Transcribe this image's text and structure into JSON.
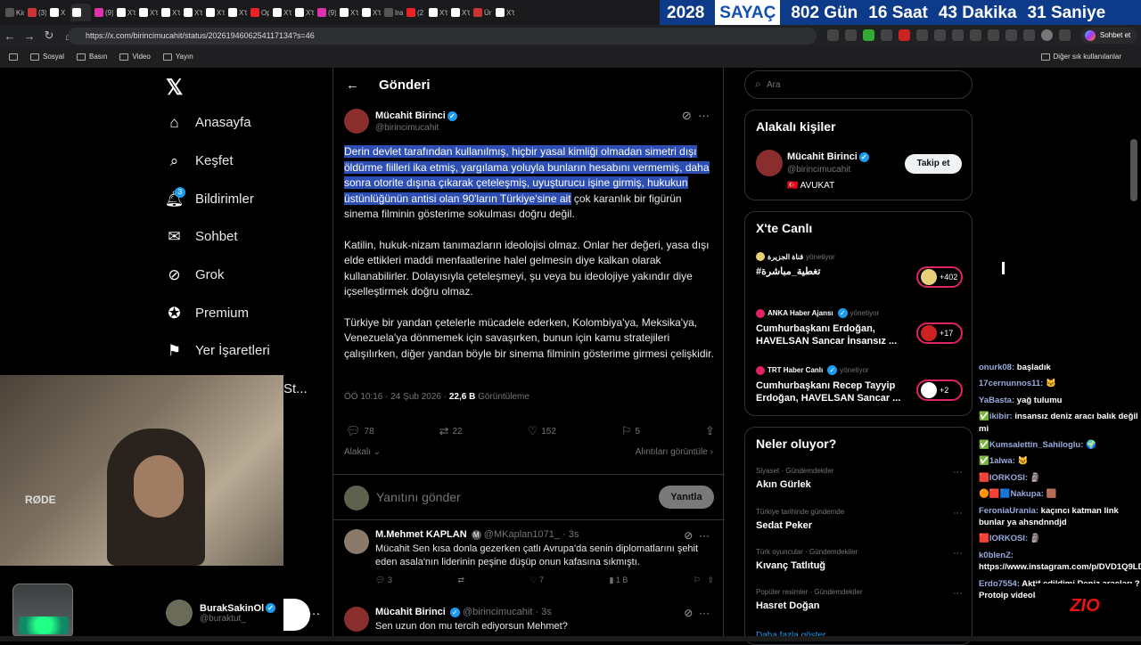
{
  "browser": {
    "tabs": [
      "Kic",
      "(3)",
      "X",
      "",
      "(9)",
      "X'te",
      "X'te",
      "X'te",
      "X'te",
      "X'te",
      "X'te",
      "Op",
      "X'te",
      "X'te",
      "(9)",
      "X'te",
      "X'te",
      "Ira",
      "(2",
      "X'te",
      "X'te",
      "Üri",
      "X'te"
    ],
    "url": "https://x.com/birincimucahit/status/2026194606254117134?s=46",
    "sohbet_label": "Sohbet et",
    "bookmarks": [
      "Sosyal",
      "Basın",
      "Video",
      "Yayın"
    ],
    "other_bookmarks": "Diğer sık kullanılanlar"
  },
  "counter": {
    "year": "2028",
    "label": "SAYAÇ",
    "days": "802 Gün",
    "hours": "16 Saat",
    "minutes": "43 Dakika",
    "seconds": "31 Saniye"
  },
  "nav": {
    "items": [
      "Anasayfa",
      "Keşfet",
      "Bildirimler",
      "Sohbet",
      "Grok",
      "Premium",
      "Yer İşaretleri",
      "St..."
    ],
    "notif_badge": "3"
  },
  "profile": {
    "name": "BurakSakinOl",
    "handle": "@buraktut_"
  },
  "header": {
    "title": "Gönderi"
  },
  "post": {
    "name": "Mücahit Birinci",
    "handle": "@birincimucahit",
    "highlighted": "Derin devlet tarafından kullanılmış, hiçbir yasal kimliği olmadan simetri dışı öldürme fiilleri ika etmiş, yargılama yoluyla bunların hesabını vermemiş, daha sonra otorite dışına çıkarak çeteleşmiş, uyuşturucu işine girmiş, hukukun üstünlüğünün antisi olan 90'ların Türkiye'sine ait",
    "p1_rest": " çok karanlık bir figürün sinema filminin gösterime sokulması doğru değil.",
    "p2": "Katilin, hukuk-nizam tanımazların ideolojisi olmaz. Onlar her değeri, yasa dışı elde ettikleri maddi menfaatlerine halel gelmesin diye kalkan olarak kullanabilirler. Dolayısıyla çeteleşmeyi, şu veya bu ideolojiye yakındır diye içselleştirmek doğru olmaz.",
    "p3": "Türkiye bir yandan çetelerle mücadele ederken, Kolombiya'ya, Meksika'ya, Venezuela'ya dönmemek için savaşırken, bunun için kamu stratejileri çalışılırken, diğer yandan böyle bir sinema filminin gösterime girmesi çelişkidir.",
    "time": "ÖÖ 10:16 · 24 Şub 2026 · ",
    "views": "22,6 B",
    "views_label": " Görüntüleme",
    "replies": "78",
    "reposts": "22",
    "likes": "152",
    "bookmarks": "5",
    "relevant": "Alakalı",
    "quotes": "Alıntıları görüntüle"
  },
  "reply_box": {
    "placeholder": "Yanıtını gönder",
    "button": "Yanıtla"
  },
  "comments": [
    {
      "name": "M.Mehmet KAPLAN",
      "handle": "@MKaplan1071_ · 3s",
      "text": "Mücahit Sen kısa donla gezerken çatlı Avrupa'da senin diplomatlarını şehit eden asala'nın liderinin peşine düşüp onun kafasına sıkmıştı.",
      "replies": "3",
      "likes": "7",
      "views": "1 B"
    },
    {
      "name": "Mücahit Birinci",
      "handle": "@birincimucahit · 3s",
      "text": "Sen uzun don mu tercih ediyorsun Mehmet?"
    }
  ],
  "search": {
    "placeholder": "Ara"
  },
  "related": {
    "title": "Alakalı kişiler",
    "name": "Mücahit Birinci",
    "handle": "@birincimucahit",
    "bio": "🇹🇷 AVUKAT",
    "follow": "Takip et"
  },
  "live": {
    "title": "X'te Canlı",
    "items": [
      {
        "source": "قناة الجزيرة",
        "role": "yönetiyor",
        "title": "#تغطية_مباشرة",
        "count": "+402"
      },
      {
        "source": "ANKA Haber Ajansı",
        "role": "yönetiyor",
        "title": "Cumhurbaşkanı Erdoğan, HAVELSAN Sancar İnsansız ...",
        "count": "+17"
      },
      {
        "source": "TRT Haber Canlı",
        "role": "yönetiyor",
        "title": "Cumhurbaşkanı Recep Tayyip Erdoğan, HAVELSAN Sancar ...",
        "count": "+2"
      }
    ]
  },
  "trends": {
    "title": "Neler oluyor?",
    "items": [
      {
        "cat": "Siyaset · Gündemdekiler",
        "name": "Akın Gürlek"
      },
      {
        "cat": "Türkiye tarihinde gündemde",
        "name": "Sedat Peker"
      },
      {
        "cat": "Türk oyuncular · Gündemdekiler",
        "name": "Kıvanç Tatlıtuğ"
      },
      {
        "cat": "Popüler resimler · Gündemdekiler",
        "name": "Hasret Doğan"
      }
    ],
    "more": "Daha fazla göster"
  },
  "chat": [
    {
      "user": "onurk08:",
      "msg": " başladık"
    },
    {
      "user": "17cernunnos11:",
      "msg": " 🐱"
    },
    {
      "user": "YaBasta:",
      "msg": " yağ tulumu"
    },
    {
      "user": "✅ikibir:",
      "msg": " insansız deniz aracı balık değil mi"
    },
    {
      "user": "✅Kumsalettin_Sahiloglu:",
      "msg": " 🌍"
    },
    {
      "user": "✅1alwa:",
      "msg": " 🐱"
    },
    {
      "user": "🟥IORKOSI:",
      "msg": " 🗿"
    },
    {
      "user": "🟠🟥🟦Nakupa:",
      "msg": " 🟫"
    },
    {
      "user": "FeroniaUrania:",
      "msg": " kaçıncı katman link bunlar ya ahsndnndjd"
    },
    {
      "user": "🟥IORKOSI:",
      "msg": " 🗿"
    },
    {
      "user": "k0blenZ:",
      "msg": " https://www.instagram.com/p/DVD1Q9LDAu6/"
    },
    {
      "user": "Erdo7554:",
      "msg": " Aktif edildimi Deniz araçları ? Protoip videoları izlediydim ben"
    }
  ],
  "overlay": {
    "mic_label": "RØDE",
    "zio": "ZIO"
  }
}
